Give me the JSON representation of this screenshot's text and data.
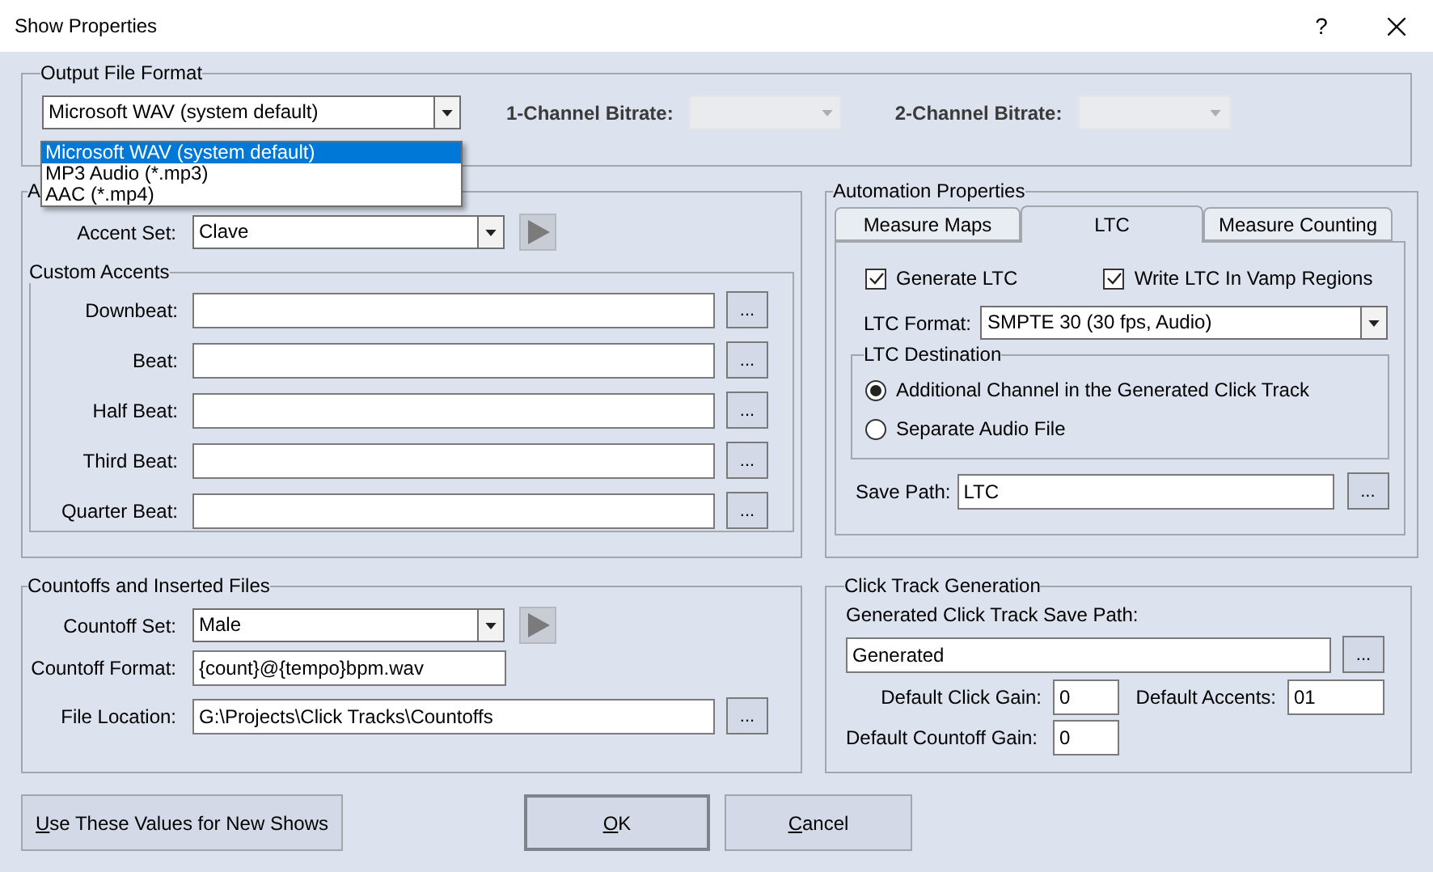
{
  "window": {
    "title": "Show Properties",
    "help": "?"
  },
  "output_file_format": {
    "title": "Output File Format",
    "format": {
      "value": "Microsoft WAV (system default)",
      "expanded": true,
      "options": [
        {
          "label": "Microsoft WAV (system default)",
          "selected": true
        },
        {
          "label": "MP3 Audio (*.mp3)",
          "selected": false
        },
        {
          "label": "AAC (*.mp4)",
          "selected": false
        }
      ]
    },
    "bitrate_1": {
      "label": "1-Channel Bitrate:",
      "disabled": true
    },
    "bitrate_2": {
      "label": "2-Channel Bitrate:",
      "disabled": true
    }
  },
  "accent_sounds": {
    "title": "A",
    "accent_set": {
      "label": "Accent Set:",
      "value": "Clave"
    },
    "custom_accents": {
      "title": "Custom Accents",
      "rows": [
        {
          "label": "Downbeat:",
          "browse": "..."
        },
        {
          "label": "Beat:",
          "browse": "..."
        },
        {
          "label": "Half Beat:",
          "browse": "..."
        },
        {
          "label": "Third Beat:",
          "browse": "..."
        },
        {
          "label": "Quarter Beat:",
          "browse": "..."
        }
      ]
    }
  },
  "countoffs": {
    "title": "Countoffs and Inserted Files",
    "countoff_set": {
      "label": "Countoff Set:",
      "value": "Male"
    },
    "countoff_format": {
      "label": "Countoff Format:",
      "value": "{count}@{tempo}bpm.wav"
    },
    "file_location": {
      "label": "File Location:",
      "value": "G:\\Projects\\Click Tracks\\Countoffs",
      "browse": "..."
    }
  },
  "automation": {
    "title": "Automation Properties",
    "tabs": [
      {
        "label": "Measure Maps",
        "selected": false
      },
      {
        "label": "LTC",
        "selected": true
      },
      {
        "label": "Measure Counting",
        "selected": false
      }
    ],
    "generate_ltc": {
      "label": "Generate LTC",
      "checked": true
    },
    "write_ltc_vamp": {
      "label": "Write LTC In Vamp Regions",
      "checked": true
    },
    "ltc_format": {
      "label": "LTC Format:",
      "value": "SMPTE 30 (30 fps, Audio)"
    },
    "destination": {
      "title": "LTC Destination",
      "options": [
        {
          "label": "Additional Channel in the Generated Click Track",
          "selected": true
        },
        {
          "label": "Separate Audio File",
          "selected": false
        }
      ]
    },
    "save_path": {
      "label": "Save Path:",
      "value": "LTC",
      "browse": "..."
    }
  },
  "click_track": {
    "title": "Click Track Generation",
    "save_path_label": "Generated Click Track Save Path:",
    "save_path": "Generated",
    "browse": "...",
    "click_gain": {
      "label": "Default Click Gain:",
      "value": "0"
    },
    "accents": {
      "label": "Default Accents:",
      "value": "01"
    },
    "countoff_gain": {
      "label": "Default Countoff Gain:",
      "value": "0"
    }
  },
  "buttons": [
    {
      "label": "Use These Values for New Shows",
      "default": false
    },
    {
      "label": "OK",
      "default": true
    },
    {
      "label": "Cancel",
      "default": false
    }
  ]
}
